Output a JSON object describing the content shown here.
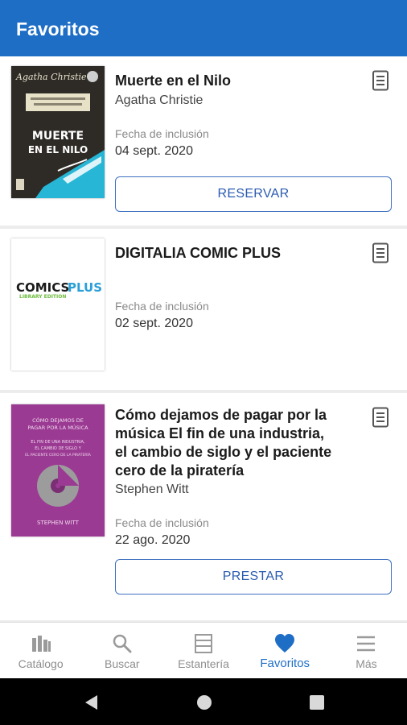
{
  "appbar": {
    "title": "Favoritos"
  },
  "items": [
    {
      "title": "Muerte en el Nilo",
      "author": "Agatha Christie",
      "date_label": "Fecha de inclusión",
      "date": "04 sept. 2020",
      "action": "RESERVAR",
      "cover": {
        "brand": "Agatha Christie",
        "title_line1": "MUERTE",
        "title_line2": "EN EL NILO",
        "colors": {
          "bg": "#2e2b27",
          "accent": "#27b6d6",
          "band": "#e7e1c8"
        }
      }
    },
    {
      "title": "DIGITALIA COMIC PLUS",
      "author": "",
      "date_label": "Fecha de inclusión",
      "date": "02 sept. 2020",
      "action": "",
      "cover": {
        "logo_part1": "COMICS",
        "logo_part2": "PLUS",
        "logo_sub": "LIBRARY EDITION",
        "colors": {
          "part1": "#1a1a1a",
          "part2": "#2a9fd8",
          "sub": "#6cbb3c"
        }
      }
    },
    {
      "title": "Cómo dejamos de pagar por la música El fin de una industria, el cambio de siglo y el paciente cero de la piratería",
      "title_lines": [
        "Cómo dejamos de pagar por la",
        "música El fin de una industria,",
        "el cambio de siglo y el paciente",
        "cero de la piratería"
      ],
      "author": "Stephen Witt",
      "date_label": "Fecha de inclusión",
      "date": "22 ago. 2020",
      "action": "PRESTAR",
      "cover": {
        "top_line1": "CÓMO DEJAMOS DE",
        "top_line2": "PAGAR POR LA MÚSICA",
        "mid_line1": "EL FIN DE UNA INDUSTRIA,",
        "mid_line2": "EL CAMBIO DE SIGLO Y",
        "mid_line3": "EL PACIENTE CERO DE LA PIRATERÍA",
        "author": "STEPHEN WITT",
        "colors": {
          "bg": "#9b3a93",
          "disc": "#9c9c9c"
        }
      }
    }
  ],
  "bottom_nav": [
    {
      "label": "Catálogo",
      "icon": "catalog-icon",
      "active": false
    },
    {
      "label": "Buscar",
      "icon": "search-icon",
      "active": false
    },
    {
      "label": "Estantería",
      "icon": "shelf-icon",
      "active": false
    },
    {
      "label": "Favoritos",
      "icon": "heart-icon",
      "active": true
    },
    {
      "label": "Más",
      "icon": "menu-icon",
      "active": false
    }
  ],
  "colors": {
    "primary": "#1f6ec6",
    "button_border": "#3d70c0",
    "inactive": "#8e8e8e"
  }
}
